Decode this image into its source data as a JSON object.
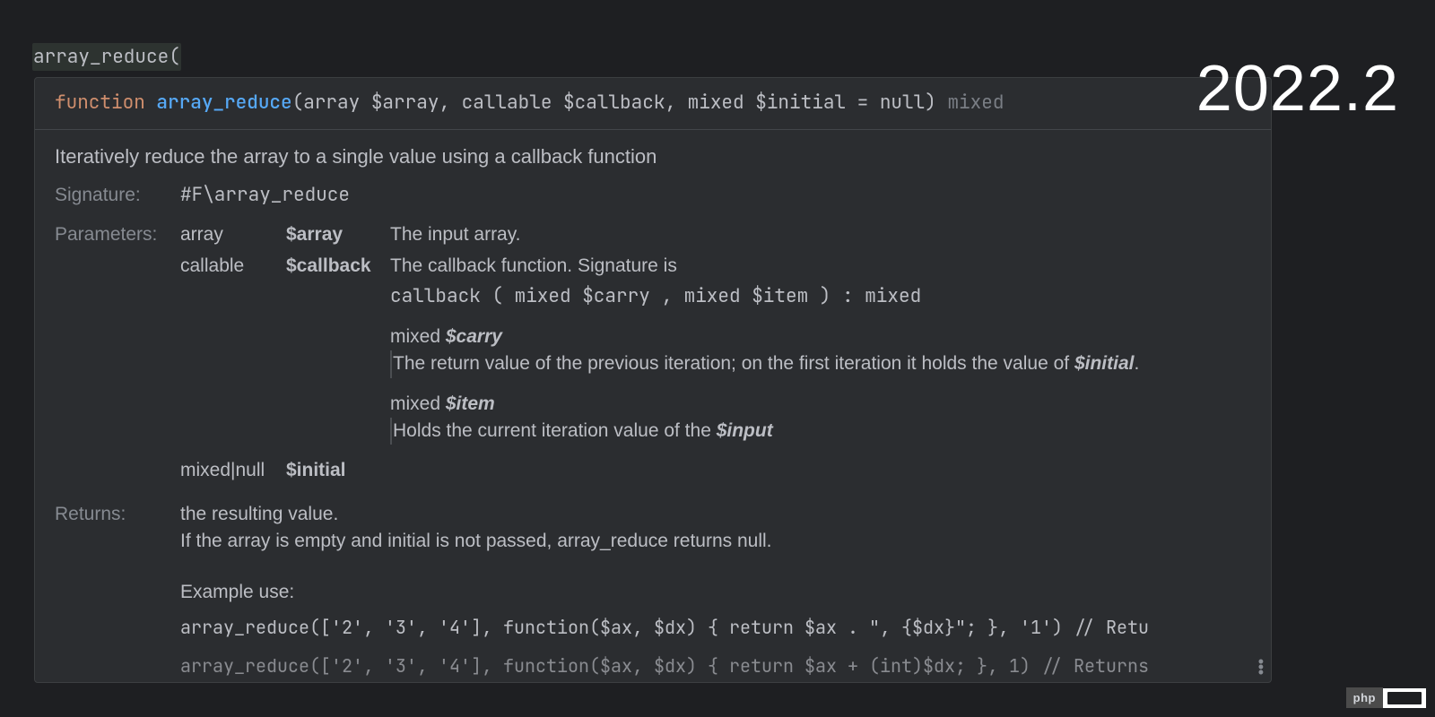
{
  "editor": {
    "typed_text": "array_reduce("
  },
  "version": "2022.2",
  "signature": {
    "keyword": "function",
    "name": "array_reduce",
    "params_raw": "(array $array, callable $callback, mixed $initial = null)",
    "return_type": "mixed"
  },
  "doc": {
    "summary": "Iteratively reduce the array to a single value using a callback function",
    "signature_label": "Signature:",
    "signature_value": "#F\\array_reduce",
    "parameters_label": "Parameters:",
    "params": [
      {
        "type": "array",
        "name": "$array",
        "desc": "The input array."
      },
      {
        "type": "callable",
        "name": "$callback",
        "desc": "The callback function. Signature is",
        "callback_sig": "callback ( mixed $carry , mixed $item ) : mixed",
        "sub": [
          {
            "type": "mixed",
            "name": "$carry",
            "desc_pre": "The return value of the previous iteration; on the first iteration it holds the value of ",
            "desc_em": "$initial",
            "desc_post": "."
          },
          {
            "type": "mixed",
            "name": "$item",
            "desc_pre": "Holds the current iteration value of the ",
            "desc_em": "$input",
            "desc_post": ""
          }
        ]
      },
      {
        "type": "mixed|null",
        "name": "$initial",
        "desc": ""
      }
    ],
    "returns_label": "Returns:",
    "returns_line1": "the resulting value.",
    "returns_line2": "If the array is empty and initial is not passed, array_reduce returns null.",
    "example_label": "Example use:",
    "example1": "array_reduce(['2', '3', '4'], function($ax, $dx) { return $ax . \", {$dx}\"; }, '1')  // Retu",
    "example2": "array_reduce(['2', '3', '4'], function($ax, $dx) { return $ax + (int)$dx; }, 1)  // Returns"
  },
  "status": {
    "php_label": "php"
  }
}
